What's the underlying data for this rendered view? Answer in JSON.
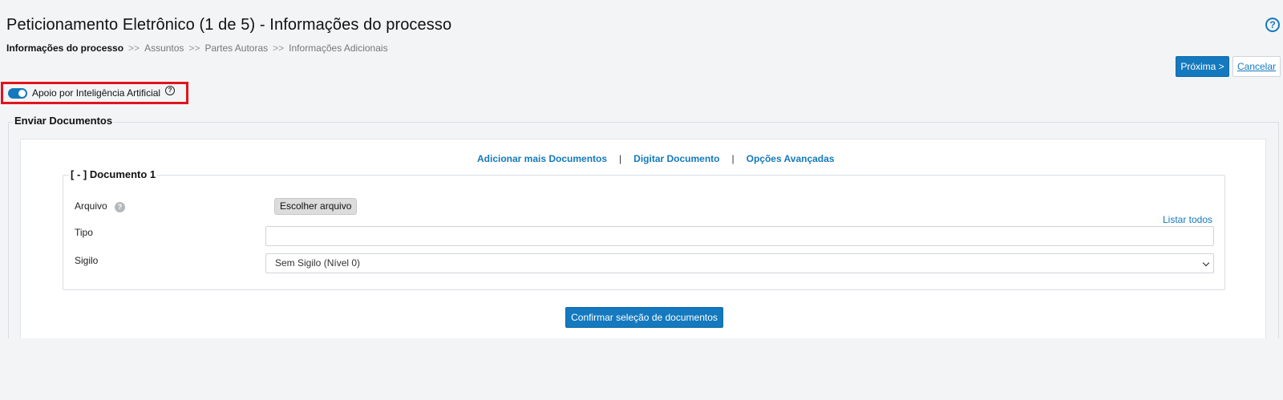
{
  "header": {
    "title": "Peticionamento Eletrônico (1 de 5) - Informações do processo",
    "help_icon": "question-circle-icon"
  },
  "breadcrumb": {
    "items": [
      "Informações do processo",
      "Assuntos",
      "Partes Autoras",
      "Informações Adicionais"
    ],
    "separator": ">>"
  },
  "actions": {
    "next_label": "Próxima >",
    "cancel_label": "Cancelar"
  },
  "ai_support": {
    "label": "Apoio por Inteligência Artificial",
    "enabled": true,
    "help_glyph": "?"
  },
  "send_documents": {
    "legend": "Enviar Documentos",
    "links": [
      "Adicionar mais Documentos",
      "Digitar Documento",
      "Opções Avançadas"
    ],
    "link_separator": "|",
    "document": {
      "legend": "[ - ] Documento 1",
      "file_label": "Arquivo",
      "file_info_glyph": "?",
      "file_button": "Escolher arquivo",
      "list_all": "Listar todos",
      "type_label": "Tipo",
      "type_value": "",
      "secrecy_label": "Sigilo",
      "secrecy_value": "Sem Sigilo (Nível 0)"
    },
    "confirm_label": "Confirmar seleção de documentos"
  },
  "colors": {
    "primary": "#1479be",
    "highlight_border": "#e0151d",
    "background": "#f3f4f6"
  }
}
